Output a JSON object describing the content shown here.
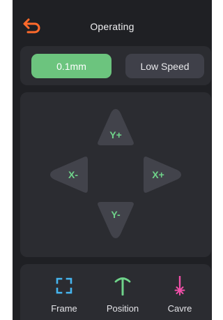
{
  "header": {
    "title": "Operating",
    "back_icon": "undo-arrow-icon"
  },
  "settings": {
    "step_label": "0.1mm",
    "speed_label": "Low Speed"
  },
  "jog": {
    "up": "Y+",
    "down": "Y-",
    "left": "X-",
    "right": "X+"
  },
  "tools": [
    {
      "label": "Frame",
      "icon": "frame-icon"
    },
    {
      "label": "Position",
      "icon": "position-pin-icon"
    },
    {
      "label": "Cavre",
      "icon": "laser-icon"
    }
  ],
  "colors": {
    "background": "#1f2024",
    "card": "#2b2c31",
    "accent_green": "#6cc47e",
    "back_orange": "#ff6a2b",
    "frame_blue": "#46b6f0",
    "position_green": "#6fd38a",
    "laser_pink": "#f04fa8"
  }
}
